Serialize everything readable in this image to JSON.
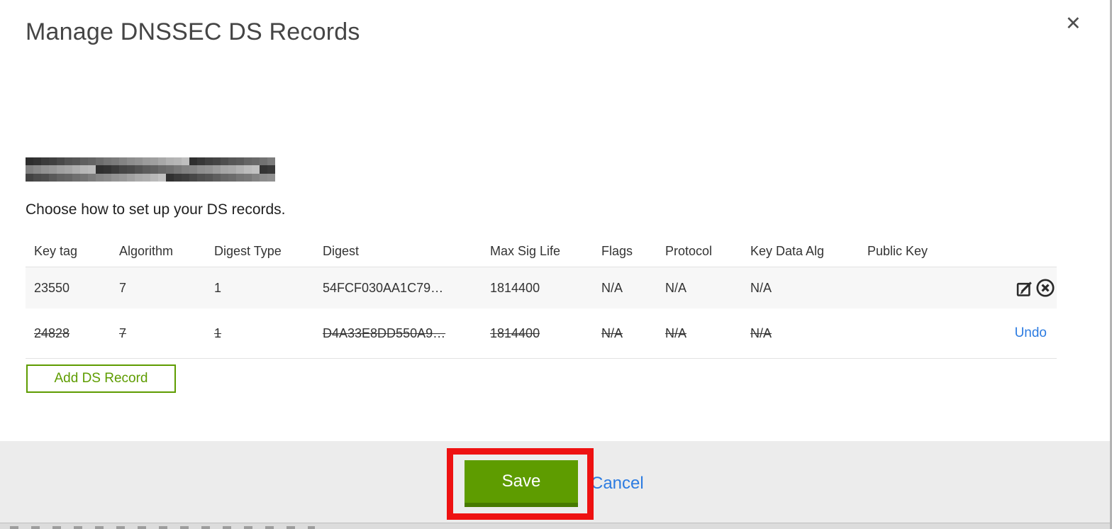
{
  "modal": {
    "title": "Manage DNSSEC DS Records",
    "instruction": "Choose how to set up your DS records.",
    "table": {
      "columns": [
        "Key tag",
        "Algorithm",
        "Digest Type",
        "Digest",
        "Max Sig Life",
        "Flags",
        "Protocol",
        "Key Data Alg",
        "Public Key"
      ],
      "rows": [
        {
          "key_tag": "23550",
          "algorithm": "7",
          "digest_type": "1",
          "digest": "54FCF030AA1C79…",
          "max_sig_life": "1814400",
          "flags": "N/A",
          "protocol": "N/A",
          "key_data_alg": "N/A",
          "public_key": "",
          "status": "active"
        },
        {
          "key_tag": "24828",
          "algorithm": "7",
          "digest_type": "1",
          "digest": "D4A33E8DD550A9…",
          "max_sig_life": "1814400",
          "flags": "N/A",
          "protocol": "N/A",
          "key_data_alg": "N/A",
          "public_key": "",
          "status": "marked-for-deletion",
          "undo_label": "Undo"
        }
      ]
    },
    "add_ds_record_label": "Add DS Record",
    "save_label": "Save",
    "cancel_label": "Cancel"
  },
  "icons": {
    "close_glyph": "✕",
    "edit": "pencil-in-square",
    "delete": "x-in-circle"
  },
  "colors": {
    "button_green": "#5e9c00",
    "button_green_dark": "#477a00",
    "link_blue": "#2d7ce1",
    "annotation_red": "#ee1111"
  }
}
